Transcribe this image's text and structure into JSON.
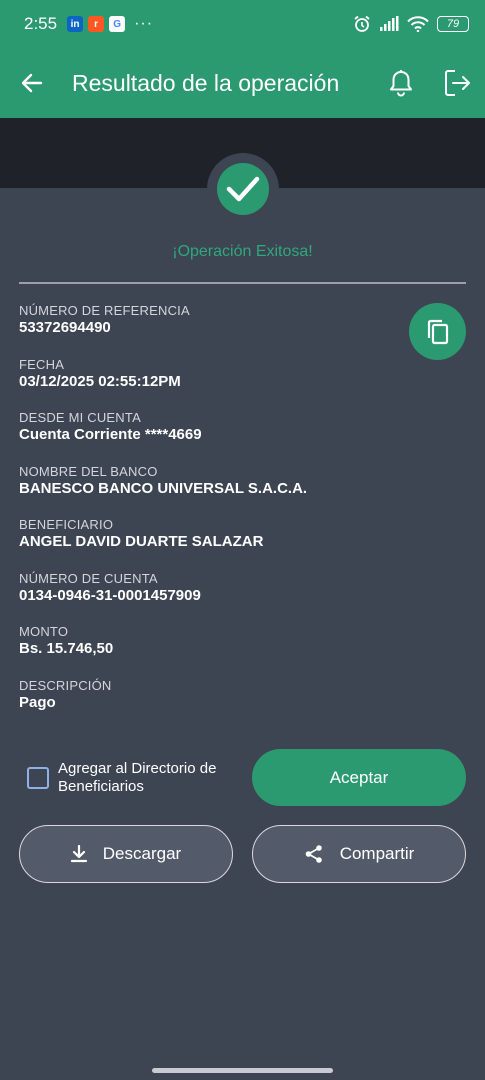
{
  "statusbar": {
    "time": "2:55",
    "apps": [
      {
        "icon": "linkedin-icon",
        "label": "in",
        "color": "#0a66c2"
      },
      {
        "icon": "reddit-icon",
        "label": "r",
        "color": "#ff5722"
      },
      {
        "icon": "google-icon",
        "label": "G",
        "color": "#ffffff"
      }
    ],
    "more": "···",
    "battery": "79"
  },
  "appbar": {
    "title": "Resultado de la operación"
  },
  "result": {
    "message": "¡Operación Exitosa!"
  },
  "fields": [
    {
      "label": "NÚMERO DE REFERENCIA",
      "value": "53372694490"
    },
    {
      "label": "FECHA",
      "value": "03/12/2025 02:55:12PM"
    },
    {
      "label": "DESDE MI CUENTA",
      "value": "Cuenta Corriente ****4669"
    },
    {
      "label": "NOMBRE DEL BANCO",
      "value": "BANESCO BANCO UNIVERSAL S.A.C.A."
    },
    {
      "label": "BENEFICIARIO",
      "value": "ANGEL DAVID DUARTE SALAZAR"
    },
    {
      "label": "NÚMERO DE CUENTA",
      "value": "0134-0946-31-0001457909"
    },
    {
      "label": "MONTO",
      "value": "Bs. 15.746,50"
    },
    {
      "label": "DESCRIPCIÓN",
      "value": "Pago"
    }
  ],
  "actions": {
    "add_directory_label": "Agregar al Directorio de Beneficiarios",
    "add_directory_checked": false,
    "accept_label": "Aceptar",
    "download_label": "Descargar",
    "share_label": "Compartir"
  },
  "colors": {
    "accent": "#2b9a70",
    "background": "#3d4452",
    "band": "#1f2228"
  }
}
